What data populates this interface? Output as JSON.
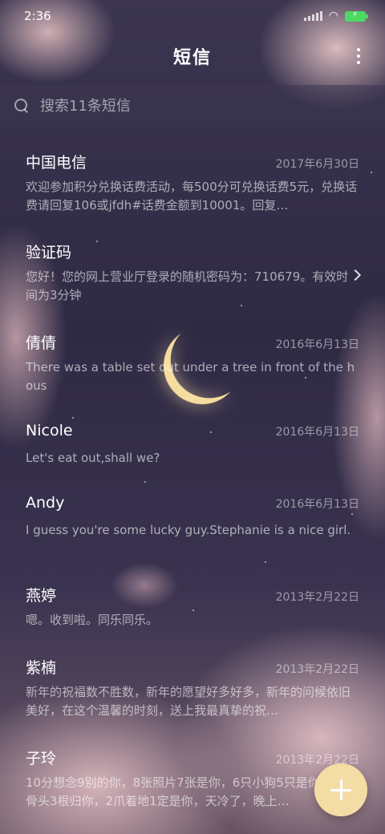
{
  "status_bar": {
    "time": "2:36"
  },
  "header": {
    "title": "短信"
  },
  "search": {
    "placeholder": "搜索11条短信"
  },
  "messages": [
    {
      "name": "中国电信",
      "date": "2017年6月30日",
      "preview": "欢迎参加积分兑换话费活动，每500分可兑换话费5元，兑换话费请回复106或jfdh#话费金额到10001。回复…"
    },
    {
      "name": "验证码",
      "date": "",
      "preview": "您好！您的网上营业厅登录的随机密码为：710679。有效时间为3分钟"
    },
    {
      "name": "倩倩",
      "date": "2016年6月13日",
      "preview": "There was a table set out under a tree in front of the hous"
    },
    {
      "name": "Nicole",
      "date": "2016年6月13日",
      "preview": "Let's eat out,shall we?"
    },
    {
      "name": "Andy",
      "date": "2016年6月13日",
      "preview": "I guess you're some lucky guy.Stephanie is a nice girl."
    },
    {
      "name": "燕婷",
      "date": "2013年2月22日",
      "preview": "嗯。收到啦。同乐同乐。"
    },
    {
      "name": "紫楠",
      "date": "2013年2月22日",
      "preview": "新年的祝福数不胜数，新年的愿望好多好多，新年的问候依旧美好，在这个温馨的时刻，送上我最真挚的祝…"
    },
    {
      "name": "子玲",
      "date": "2013年2月22日",
      "preview": "10分想念9别的你，8张照片7张是你，6只小狗5只是你，4根骨头3根归你，2爪着地1定是你，天冷了，晚上…"
    }
  ],
  "colors": {
    "accent": "#f3dda5",
    "battery": "#4cd964"
  },
  "icons": {
    "search": "search-icon",
    "more": "more-vertical-icon",
    "chevron": "chevron-right-icon",
    "compose": "plus-icon"
  }
}
